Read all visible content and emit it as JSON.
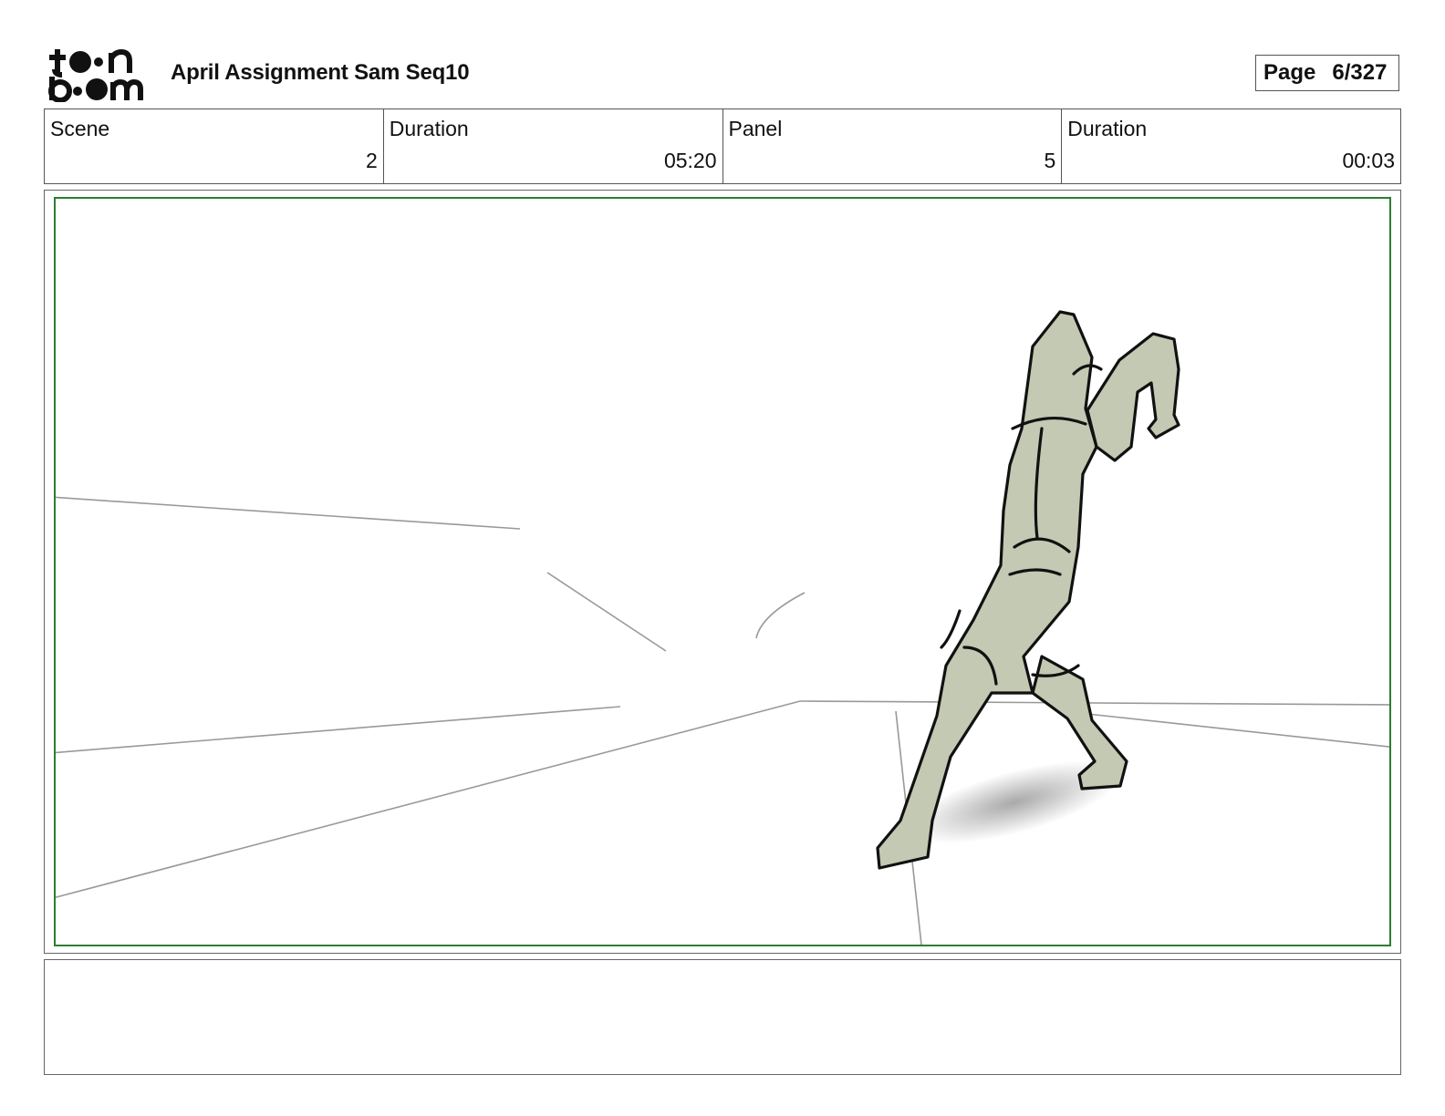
{
  "header": {
    "logo_alt": "toon boom",
    "title": "April Assignment Sam Seq10",
    "page_label": "Page",
    "page_value": "6/327"
  },
  "info": {
    "scene_label": "Scene",
    "scene_value": "2",
    "scene_duration_label": "Duration",
    "scene_duration_value": "05:20",
    "panel_label": "Panel",
    "panel_value": "5",
    "panel_duration_label": "Duration",
    "panel_duration_value": "00:03"
  },
  "colors": {
    "frame_border": "#2e7d32",
    "figure_fill": "#c3c9b2"
  },
  "notes": {
    "text": ""
  }
}
